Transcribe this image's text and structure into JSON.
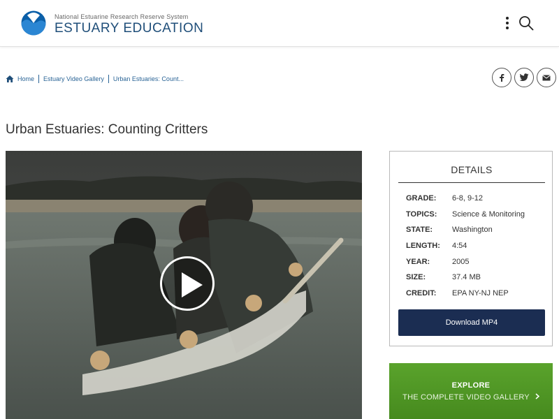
{
  "header": {
    "subtitle": "National Estuarine Research Reserve System",
    "title": "ESTUARY EDUCATION"
  },
  "breadcrumb": {
    "items": [
      "Home",
      "Estuary Video Gallery",
      "Urban Estuaries: Count..."
    ]
  },
  "page": {
    "title": "Urban Estuaries: Counting Critters"
  },
  "details": {
    "heading": "DETAILS",
    "rows": [
      {
        "label": "GRADE:",
        "value": "6-8, 9-12"
      },
      {
        "label": "TOPICS:",
        "value": "Science & Monitoring"
      },
      {
        "label": "STATE:",
        "value": "Washington"
      },
      {
        "label": "LENGTH:",
        "value": "4:54"
      },
      {
        "label": "YEAR:",
        "value": "2005"
      },
      {
        "label": "SIZE:",
        "value": "37.4 MB"
      },
      {
        "label": "CREDIT:",
        "value": "EPA NY-NJ NEP"
      }
    ],
    "download_label": "Download MP4"
  },
  "explore": {
    "title": "EXPLORE",
    "subtitle": "THE COMPLETE VIDEO GALLERY"
  },
  "icons": {
    "menu": "vertical-dots-icon",
    "search": "search-icon",
    "home": "home-icon",
    "share": [
      "facebook-icon",
      "twitter-icon",
      "email-icon"
    ],
    "play": "play-icon",
    "chevron": "chevron-right-icon"
  },
  "colors": {
    "brand_blue": "#1f4e79",
    "download_bg": "#1b2d52",
    "explore_green": "#5aa32c",
    "link": "#2a6496"
  }
}
